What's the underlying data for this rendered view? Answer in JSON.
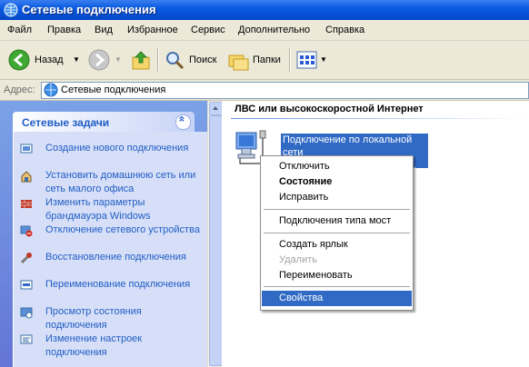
{
  "window": {
    "title": "Сетевые подключения"
  },
  "menu": [
    "Файл",
    "Правка",
    "Вид",
    "Избранное",
    "Сервис",
    "Дополнительно",
    "Справка"
  ],
  "toolbar": {
    "back_label": "Назад",
    "search_label": "Поиск",
    "folders_label": "Папки"
  },
  "address": {
    "label": "Адрес:",
    "value": "Сетевые подключения"
  },
  "tasks": {
    "header": "Сетевые задачи",
    "items": [
      {
        "label": "Создание нового подключения",
        "icon": "new-connection-icon"
      },
      {
        "label": "Установить домашнюю сеть или сеть малого офиса",
        "icon": "home-network-icon"
      },
      {
        "label": "Изменить параметры брандмауэра Windows",
        "icon": "firewall-icon"
      },
      {
        "label": "Отключение сетевого устройства",
        "icon": "disable-device-icon"
      },
      {
        "label": "Восстановление подключения",
        "icon": "repair-icon"
      },
      {
        "label": "Переименование подключения",
        "icon": "rename-icon"
      },
      {
        "label": "Просмотр состояния подключения",
        "icon": "status-icon"
      },
      {
        "label": "Изменение настроек подключения",
        "icon": "settings-icon"
      }
    ]
  },
  "group": {
    "header": "ЛВС или высокоскоростной Интернет"
  },
  "connection": {
    "label": "Подключение по локальной сети",
    "label_tail": "..."
  },
  "context_menu": {
    "items": [
      "Отключить",
      "Состояние",
      "Исправить",
      "Подключения типа мост",
      "Создать ярлык",
      "Удалить",
      "Переименовать",
      "Свойства"
    ],
    "default_item": "Состояние",
    "disabled_item": "Удалить",
    "highlighted_item": "Свойства"
  },
  "colors": {
    "titlebar": "#0a5be0",
    "selection": "#316ac5",
    "link": "#215dc6",
    "task_pane": "#d6dff7"
  }
}
